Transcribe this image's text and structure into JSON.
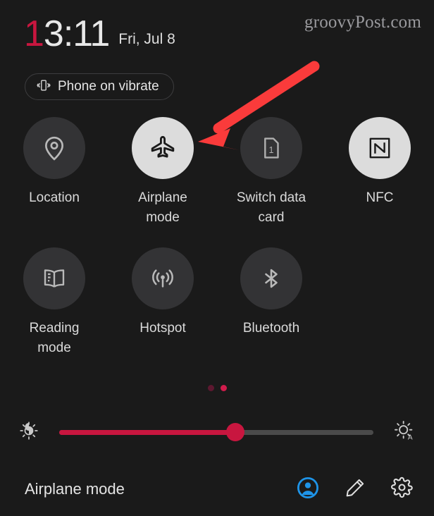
{
  "watermark": "groovyPost.com",
  "status": {
    "time_accent_digit": "1",
    "time_rest": "3:11",
    "time_full": "13:11",
    "date": "Fri, Jul 8",
    "ringer_pill": {
      "label": "Phone on vibrate",
      "icon": "vibrate-icon"
    }
  },
  "colors": {
    "background": "#1a1a1a",
    "tile_inactive": "#333335",
    "tile_active": "#dcdcdc",
    "accent_crimson": "#c8163f",
    "annotation_red": "#fa3b3b",
    "account_blue": "#1e94e8",
    "label": "#dadada"
  },
  "tiles": {
    "row1": [
      {
        "label": "Location",
        "icon": "location-pin-icon",
        "active": false,
        "state": "off"
      },
      {
        "label": "Airplane mode",
        "icon": "airplane-icon",
        "active": true,
        "state": "on"
      },
      {
        "label": "Switch data card",
        "icon": "sim-card-1-icon",
        "active": false,
        "state": "off"
      },
      {
        "label": "NFC",
        "icon": "nfc-icon",
        "active": true,
        "state": "on"
      }
    ],
    "row2": [
      {
        "label": "Reading mode",
        "icon": "book-icon",
        "active": false,
        "state": "off"
      },
      {
        "label": "Hotspot",
        "icon": "hotspot-icon",
        "active": false,
        "state": "off"
      },
      {
        "label": "Bluetooth",
        "icon": "bluetooth-icon",
        "active": false,
        "state": "off"
      }
    ]
  },
  "pager": {
    "total_pages": 2,
    "current_page": 2
  },
  "brightness": {
    "left_icon": "brightness-contrast-icon",
    "right_icon": "auto-brightness-icon",
    "value_percent": 56
  },
  "bottom_bar": {
    "title": "Airplane mode",
    "actions": [
      {
        "name": "account-icon",
        "label": "Account"
      },
      {
        "name": "edit-pencil-icon",
        "label": "Edit"
      },
      {
        "name": "settings-gear-icon",
        "label": "Settings"
      }
    ]
  },
  "annotation": {
    "type": "arrow",
    "color": "#fa3b3b",
    "points_to": "Airplane mode"
  }
}
